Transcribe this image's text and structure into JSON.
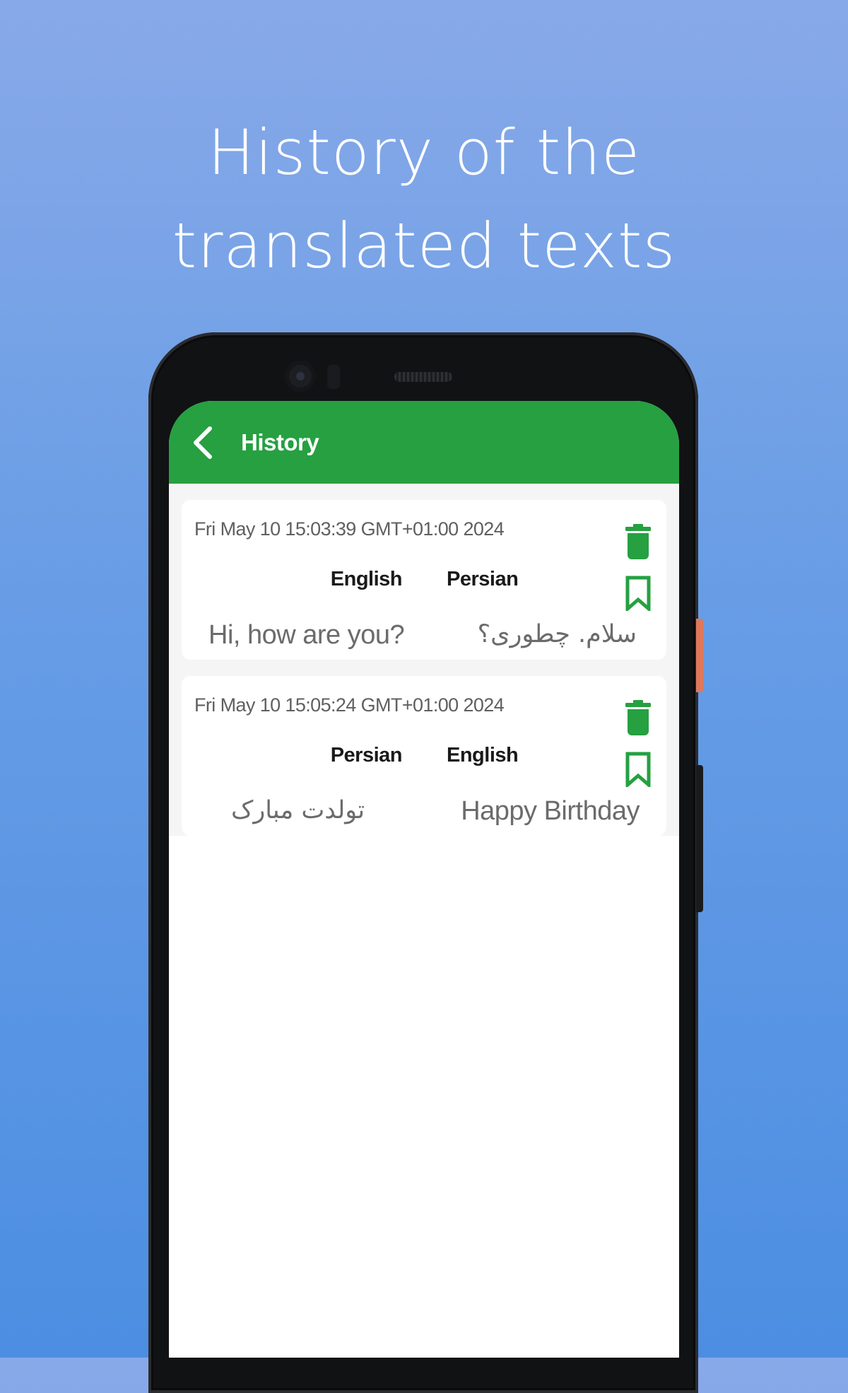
{
  "headline": "History of the translated texts",
  "appbar": {
    "title": "History"
  },
  "colors": {
    "background_top": "#88a9e8",
    "background_bottom": "#4c8ee2",
    "appbar": "#26a041",
    "icon_green": "#26a041"
  },
  "icons": {
    "back": "chevron-left",
    "delete": "trash",
    "save": "bookmark-outline"
  },
  "history": [
    {
      "timestamp": "Fri May 10 15:03:39 GMT+01:00 2024",
      "source_lang": "English",
      "target_lang": "Persian",
      "source_text": "Hi, how are you?",
      "target_text": "سلام. چطوری؟"
    },
    {
      "timestamp": "Fri May 10 15:05:24 GMT+01:00 2024",
      "source_lang": "Persian",
      "target_lang": "English",
      "source_text": "تولدت مبارک",
      "target_text": "Happy Birthday"
    }
  ]
}
